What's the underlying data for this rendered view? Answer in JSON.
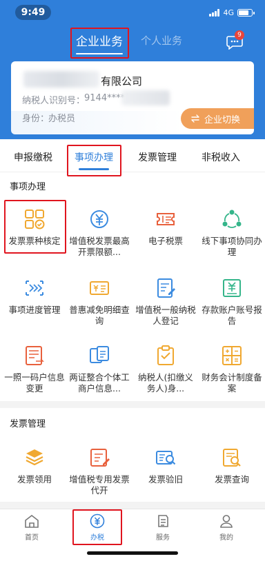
{
  "status_bar": {
    "time": "9:49",
    "network": "4G"
  },
  "top_tabs": {
    "business": "企业业务",
    "personal": "个人业务",
    "message_badge": "9"
  },
  "company": {
    "name": "有限公司",
    "tin_label": "纳税人识别号：",
    "tin_value": "9144*****",
    "role_label": "身份：",
    "role_value": "办税员",
    "switch_label": "企业切换"
  },
  "sub_tabs": [
    "申报缴税",
    "事项办理",
    "发票管理",
    "非税收入"
  ],
  "section_items": {
    "title": "事项办理",
    "items": [
      {
        "label": "发票票种核定",
        "icon": "grid-approve-icon"
      },
      {
        "label": "增值税发票最高开票限额...",
        "icon": "invoice-limit-icon"
      },
      {
        "label": "电子税票",
        "icon": "e-ticket-icon"
      },
      {
        "label": "线下事项协同办理",
        "icon": "collaborate-icon"
      },
      {
        "label": "事项进度管理",
        "icon": "progress-icon"
      },
      {
        "label": "普惠减免明细查询",
        "icon": "tax-relief-icon"
      },
      {
        "label": "增值税一般纳税人登记",
        "icon": "register-icon"
      },
      {
        "label": "存款账户账号报告",
        "icon": "account-report-icon"
      },
      {
        "label": "一照一码户信息变更",
        "icon": "info-change-icon"
      },
      {
        "label": "两证整合个体工商户信息...",
        "icon": "merge-cert-icon"
      },
      {
        "label": "纳税人(扣缴义务人)身...",
        "icon": "taxpayer-identity-icon"
      },
      {
        "label": "财务会计制度备案",
        "icon": "accounting-filing-icon"
      }
    ]
  },
  "section_invoice": {
    "title": "发票管理",
    "items": [
      {
        "label": "发票领用",
        "icon": "invoice-stack-icon"
      },
      {
        "label": "增值税专用发票代开",
        "icon": "proxy-invoice-icon"
      },
      {
        "label": "发票验旧",
        "icon": "invoice-verify-icon"
      },
      {
        "label": "发票查询",
        "icon": "invoice-search-icon"
      }
    ]
  },
  "bottom_nav": [
    {
      "label": "首页",
      "icon": "home-icon"
    },
    {
      "label": "办税",
      "icon": "tax-icon"
    },
    {
      "label": "服务",
      "icon": "service-icon"
    },
    {
      "label": "我的",
      "icon": "profile-icon"
    }
  ],
  "colors": {
    "primary": "#2f7fda",
    "accent_orange": "#f0a05a",
    "highlight_red": "#e0141e"
  }
}
